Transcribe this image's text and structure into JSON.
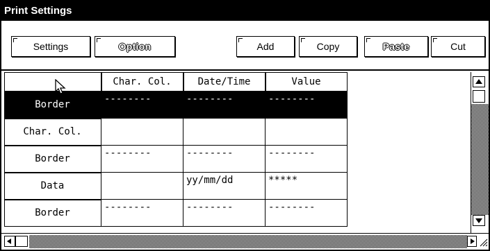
{
  "window": {
    "title": "Print Settings"
  },
  "toolbar": {
    "buttons": [
      {
        "label": "Settings",
        "enabled": true
      },
      {
        "label": "Option",
        "enabled": false
      },
      {
        "label": "Add",
        "enabled": true
      },
      {
        "label": "Copy",
        "enabled": true
      },
      {
        "label": "Paste",
        "enabled": false
      },
      {
        "label": "Cut",
        "enabled": true
      }
    ]
  },
  "grid": {
    "columns": [
      "Char. Col.",
      "Date/Time",
      "Value"
    ],
    "rows": [
      {
        "label": "Border",
        "cells": [
          "--------",
          "--------",
          "--------"
        ],
        "selected": true
      },
      {
        "label": "Char. Col.",
        "cells": [
          "",
          "",
          ""
        ],
        "selected": false
      },
      {
        "label": "Border",
        "cells": [
          "--------",
          "--------",
          "--------"
        ],
        "selected": false
      },
      {
        "label": "Data",
        "cells": [
          "",
          "yy/mm/dd",
          "*****"
        ],
        "selected": false
      },
      {
        "label": "Border",
        "cells": [
          "--------",
          "--------",
          "--------"
        ],
        "selected": false
      }
    ]
  },
  "icons": {
    "cursor": "mouse-pointer-icon",
    "scroll_up": "scroll-up-arrow-icon",
    "scroll_down": "scroll-down-arrow-icon",
    "scroll_left": "scroll-left-arrow-icon",
    "scroll_right": "scroll-right-arrow-icon",
    "resize": "resize-grip-icon"
  },
  "colors": {
    "selection_bg": "#000000",
    "selection_fg": "#ffffff",
    "title_bg": "#000000"
  }
}
